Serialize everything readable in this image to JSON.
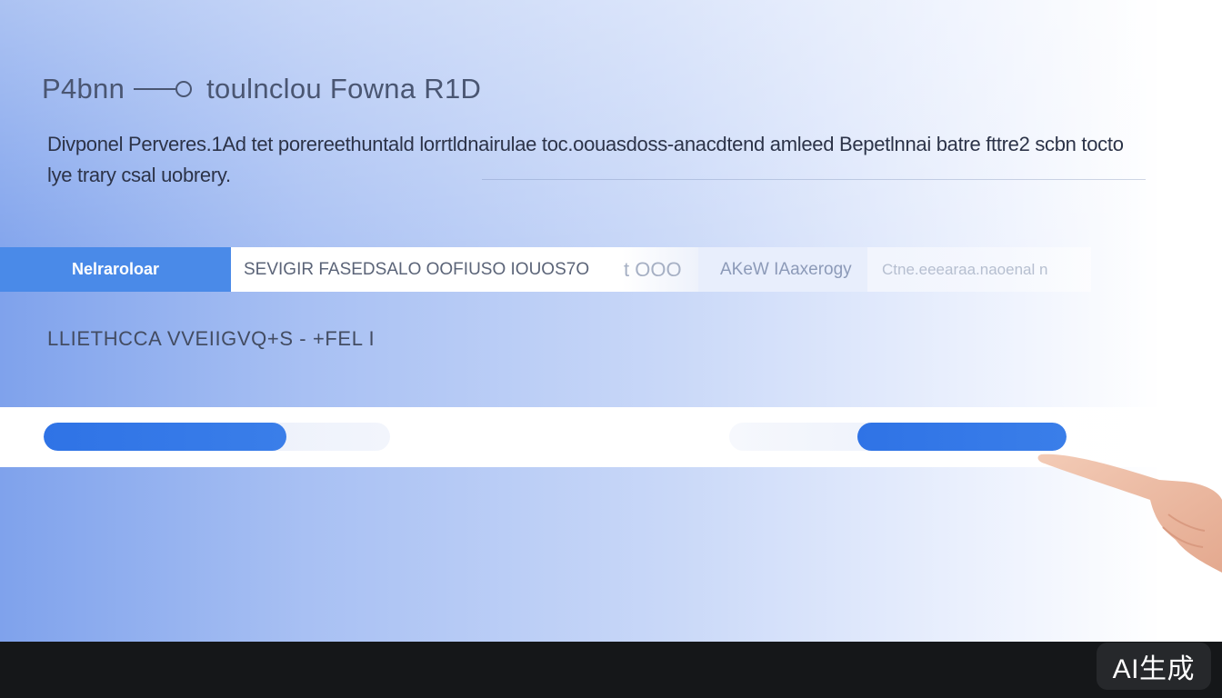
{
  "header": {
    "title_left": "P4bnn",
    "title_right": "toulnclou Fowna R1D"
  },
  "description": "Divponel Perveres.1Ad tet porereethuntald lorrtldnairulae toc.oouasdoss-anacdtend amleed Bepetlnnai batre fttre2 scbn tocto lye trary csal uobrery.",
  "tabs": [
    {
      "label": "Nelraroloar"
    },
    {
      "label": "SEVIGIR FASEDSALO OOFIUSO IOUOS7O"
    },
    {
      "label": "t OOO"
    },
    {
      "label": "AKeW IAaxerogy"
    },
    {
      "label": "Ctne.eeearaa.naoenal n"
    }
  ],
  "section_label": "LLIETHCCA VVEIIGVQ+S - +FEL I",
  "sliders": [
    {
      "fill_fraction": 0.7
    },
    {
      "fill_fraction": 0.62
    }
  ],
  "watermark": "AI生成",
  "colors": {
    "accent": "#2f73e6",
    "active_tab": "#4a8ae8"
  }
}
